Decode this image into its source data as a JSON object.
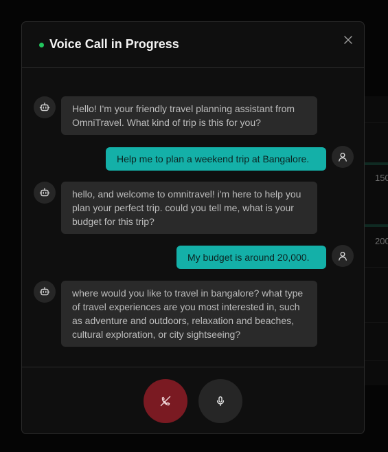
{
  "header": {
    "title": "Voice Call in Progress",
    "status_color": "#22c55e",
    "close_icon": "close-icon"
  },
  "messages": [
    {
      "role": "assistant",
      "avatar_icon": "bot-icon",
      "text": "Hello! I'm your friendly travel planning assistant from OmniTravel. What kind of trip is this for you?"
    },
    {
      "role": "user",
      "avatar_icon": "user-icon",
      "text": "Help me to plan a weekend trip at Bangalore."
    },
    {
      "role": "assistant",
      "avatar_icon": "bot-icon",
      "text": "hello, and welcome to omnitravel! i'm here to help you plan your perfect trip. could you tell me, what is your budget for this trip?"
    },
    {
      "role": "user",
      "avatar_icon": "user-icon",
      "text": "My budget is around 20,000."
    },
    {
      "role": "assistant",
      "avatar_icon": "bot-icon",
      "text": "where would you like to travel in bangalore? what type of travel experiences are you most interested in, such as adventure and outdoors, relaxation and beaches, cultural exploration, or city sightseeing?"
    }
  ],
  "controls": {
    "end_call_icon": "phone-off-icon",
    "end_call_color": "#7a1a22",
    "mic_icon": "microphone-icon"
  },
  "background": {
    "values": [
      "150",
      "200"
    ]
  },
  "colors": {
    "user_bubble": "#14b0a8",
    "assistant_bubble": "#2a2a2a",
    "modal_bg": "#0f0f0f"
  }
}
